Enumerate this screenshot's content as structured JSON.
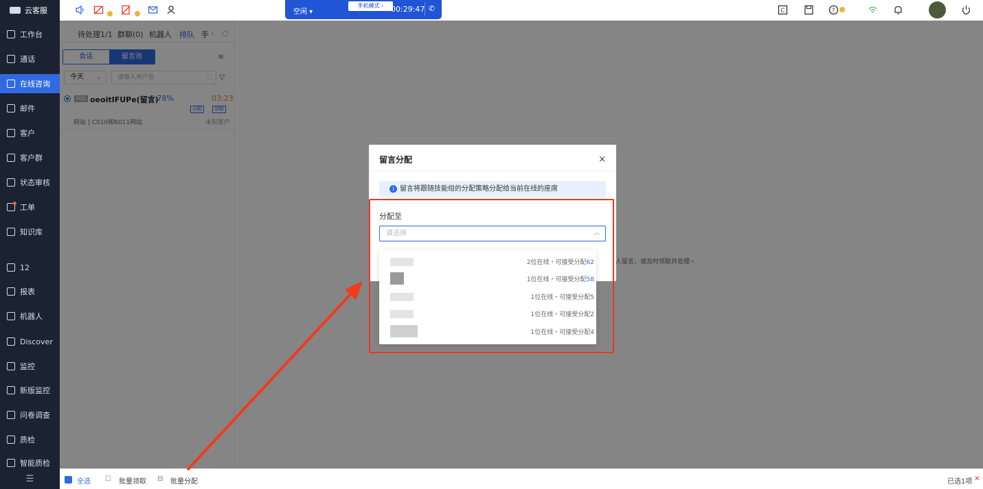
{
  "app": {
    "title": "云客服"
  },
  "sidebar": {
    "items": [
      {
        "label": "工作台"
      },
      {
        "label": "通话"
      },
      {
        "label": "在线咨询"
      },
      {
        "label": "邮件"
      },
      {
        "label": "客户"
      },
      {
        "label": "客户群"
      },
      {
        "label": "状态审核"
      },
      {
        "label": "工单"
      },
      {
        "label": "知识库"
      },
      {
        "label": "12"
      },
      {
        "label": "报表"
      },
      {
        "label": "机器人"
      },
      {
        "label": "Discover"
      },
      {
        "label": "监控"
      },
      {
        "label": "新版监控"
      },
      {
        "label": "问卷调查"
      },
      {
        "label": "质检"
      },
      {
        "label": "智能质检"
      }
    ],
    "collapse_icon": "collapse-icon"
  },
  "callbar": {
    "status": "空闲",
    "mode": "手机模式",
    "timer": "00:29:47"
  },
  "panel": {
    "tabs": [
      "待处理1/1",
      "群聊(0)",
      "机器人",
      "排队",
      "手"
    ],
    "segment": [
      "会话",
      "留言池"
    ],
    "date_value": "今天",
    "search_placeholder": "请输入用户名",
    "conversation": {
      "badge": "网站",
      "name": "oeoitIFUPe(留言)",
      "percent": "5.78%",
      "time": "03:23",
      "tags": [
        "分配",
        "领取"
      ],
      "source": "网站 | C010和6011网站",
      "customer": "未知客户"
    }
  },
  "main": {
    "empty_text": "人留言，请及时领取并处理~"
  },
  "bottombar": {
    "select_all": "全选",
    "batch_claim": "批量领取",
    "batch_assign": "批量分配",
    "selected": "已选1项"
  },
  "modal": {
    "title": "留言分配",
    "close": "×",
    "info": "留言将跟随技能组的分配策略分配给当前在线的座席",
    "field_label": "分配至",
    "select_placeholder": "请选择",
    "options": [
      {
        "online": "2位在线・可接受分配",
        "count": "62"
      },
      {
        "online": "1位在线・可接受分配",
        "count": "58"
      },
      {
        "online": "1位在线・可接受分配",
        "count": "5"
      },
      {
        "online": "1位在线・可接受分配",
        "count": "2"
      },
      {
        "online": "1位在线・可接受分配",
        "count": "4"
      }
    ]
  },
  "colors": {
    "accent": "#2f6ae0",
    "sidebar_bg": "#1b2333",
    "highlight": "#e8391f"
  }
}
